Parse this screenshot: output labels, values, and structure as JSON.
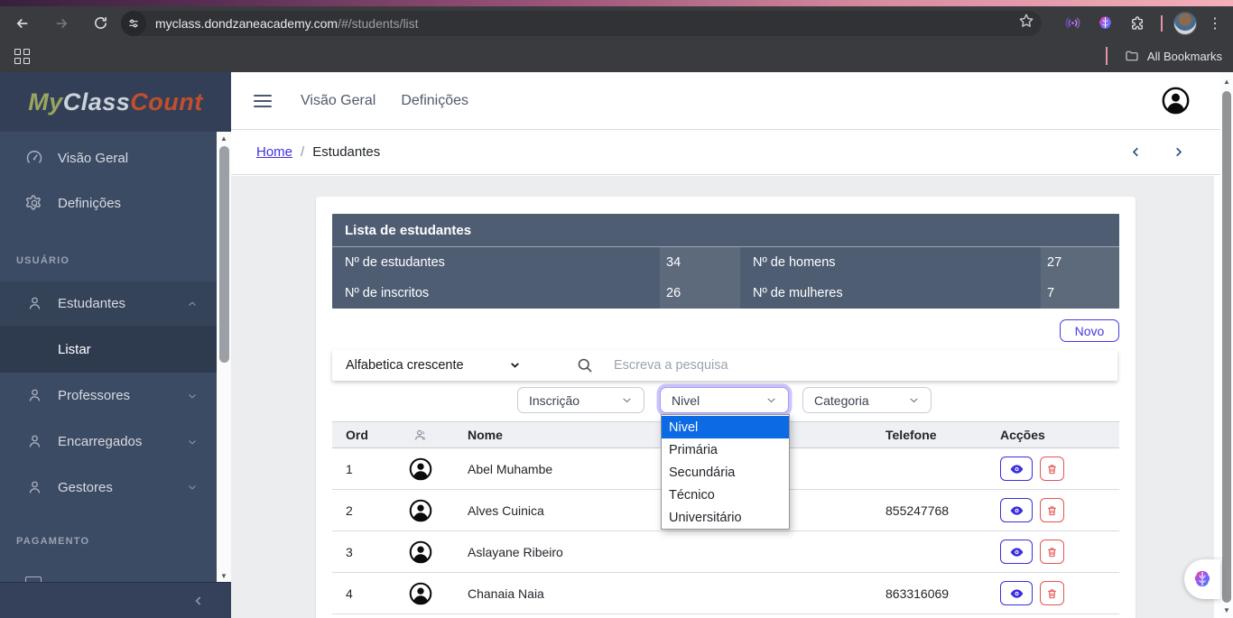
{
  "browser": {
    "url_host": "myclass.dondzaneacademy.com",
    "url_path": "/#/students/list",
    "bookmarks_label": "All Bookmarks"
  },
  "sidebar": {
    "logo": [
      "My",
      "Class",
      "Count"
    ],
    "main_items": [
      {
        "label": "Visão Geral"
      },
      {
        "label": "Definições"
      }
    ],
    "sections": {
      "user": "USUÁRIO",
      "payment": "PAGAMENTO"
    },
    "user_items": [
      {
        "label": "Estudantes"
      },
      {
        "label": "Professores"
      },
      {
        "label": "Encarregados"
      },
      {
        "label": "Gestores"
      }
    ],
    "sub_items": [
      {
        "label": "Listar"
      }
    ]
  },
  "header": {
    "links": [
      "Visão Geral",
      "Definições"
    ]
  },
  "breadcrumb": {
    "home": "Home",
    "separator": "/",
    "current": "Estudantes"
  },
  "stats": {
    "title": "Lista de estudantes",
    "cells": [
      {
        "label": "Nº de estudantes",
        "value": "34"
      },
      {
        "label": "Nº de homens",
        "value": "27"
      },
      {
        "label": "Nº de inscritos",
        "value": "26"
      },
      {
        "label": "Nº de mulheres",
        "value": "7"
      }
    ]
  },
  "actions": {
    "new_label": "Novo"
  },
  "search": {
    "sort_selected": "Alfabetica crescente",
    "placeholder": "Escreva a pesquisa"
  },
  "filters": {
    "inscricao_label": "Inscrição",
    "nivel_label": "Nivel",
    "categoria_label": "Categoria",
    "nivel_options": [
      "Nivel",
      "Primária",
      "Secundária",
      "Técnico",
      "Universitário"
    ]
  },
  "table": {
    "headers": {
      "ord": "Ord",
      "nome": "Nome",
      "telefone": "Telefone",
      "accoes": "Acções"
    },
    "rows": [
      {
        "ord": "1",
        "name": "Abel Muhambe",
        "phone": ""
      },
      {
        "ord": "2",
        "name": "Alves Cuinica",
        "phone": "855247768"
      },
      {
        "ord": "3",
        "name": "Aslayane Ribeiro",
        "phone": ""
      },
      {
        "ord": "4",
        "name": "Chanaia Naia",
        "phone": "863316069"
      }
    ]
  },
  "colors": {
    "sidebar_bg": "#3c4b64",
    "stats_bg": "#4f5d73",
    "accent_primary": "#4439e8",
    "danger": "#e55353",
    "option_selected_bg": "#0c6ae4",
    "content_bg": "#ebedef"
  }
}
